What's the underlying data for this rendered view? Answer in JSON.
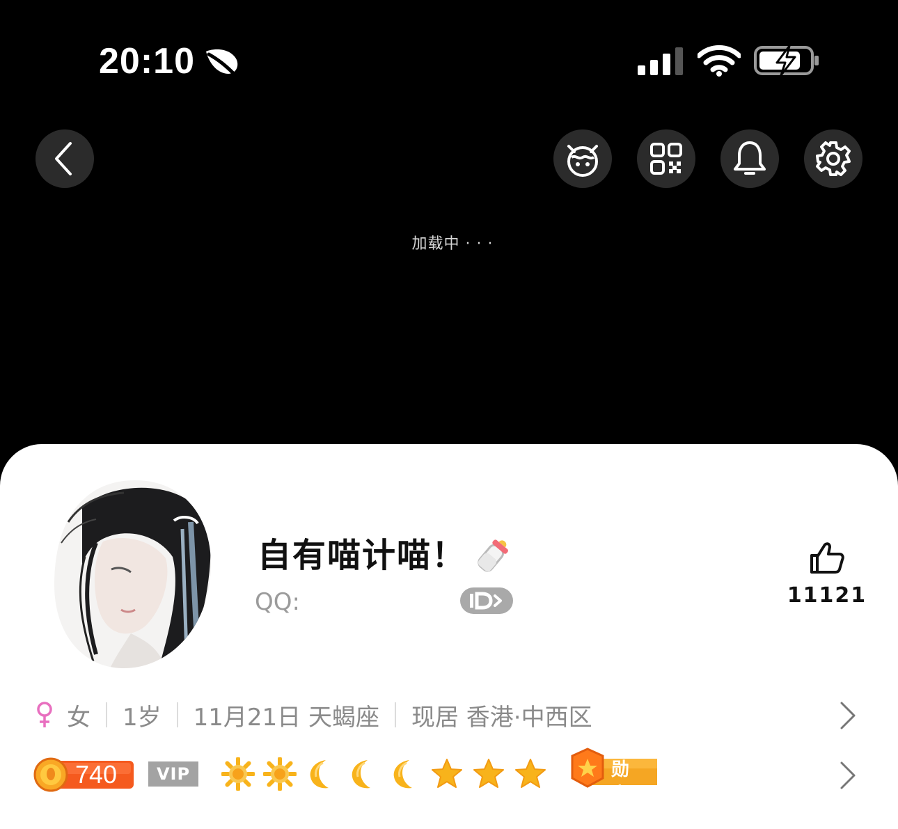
{
  "status_bar": {
    "time": "20:10",
    "icons": [
      "leaf-icon",
      "signal-icon",
      "wifi-icon",
      "battery-charging-icon"
    ]
  },
  "nav": {
    "icons": [
      "back-icon",
      "pet-icon",
      "qr-code-icon",
      "bell-icon",
      "gear-icon"
    ]
  },
  "loading": {
    "text": "加载中 · · ·"
  },
  "profile": {
    "nickname": "自有喵计喵！",
    "qq_label": "QQ:",
    "id_badge": "ID>",
    "likes": "11121"
  },
  "info": {
    "gender": "女",
    "age": "1岁",
    "birthday": "11月21日 天蝎座",
    "location": "现居 香港·中西区"
  },
  "badges": {
    "coin_value": "740",
    "vip": "VIP",
    "levels": [
      "sun",
      "sun",
      "moon",
      "moon",
      "moon",
      "star",
      "star",
      "star"
    ],
    "medal": "勋章"
  },
  "colors": {
    "coin_orange": "#f55a1e",
    "level_gold": "#f8b31b",
    "female_pink": "#e86fbf",
    "vip_gray": "#a3a3a3"
  }
}
